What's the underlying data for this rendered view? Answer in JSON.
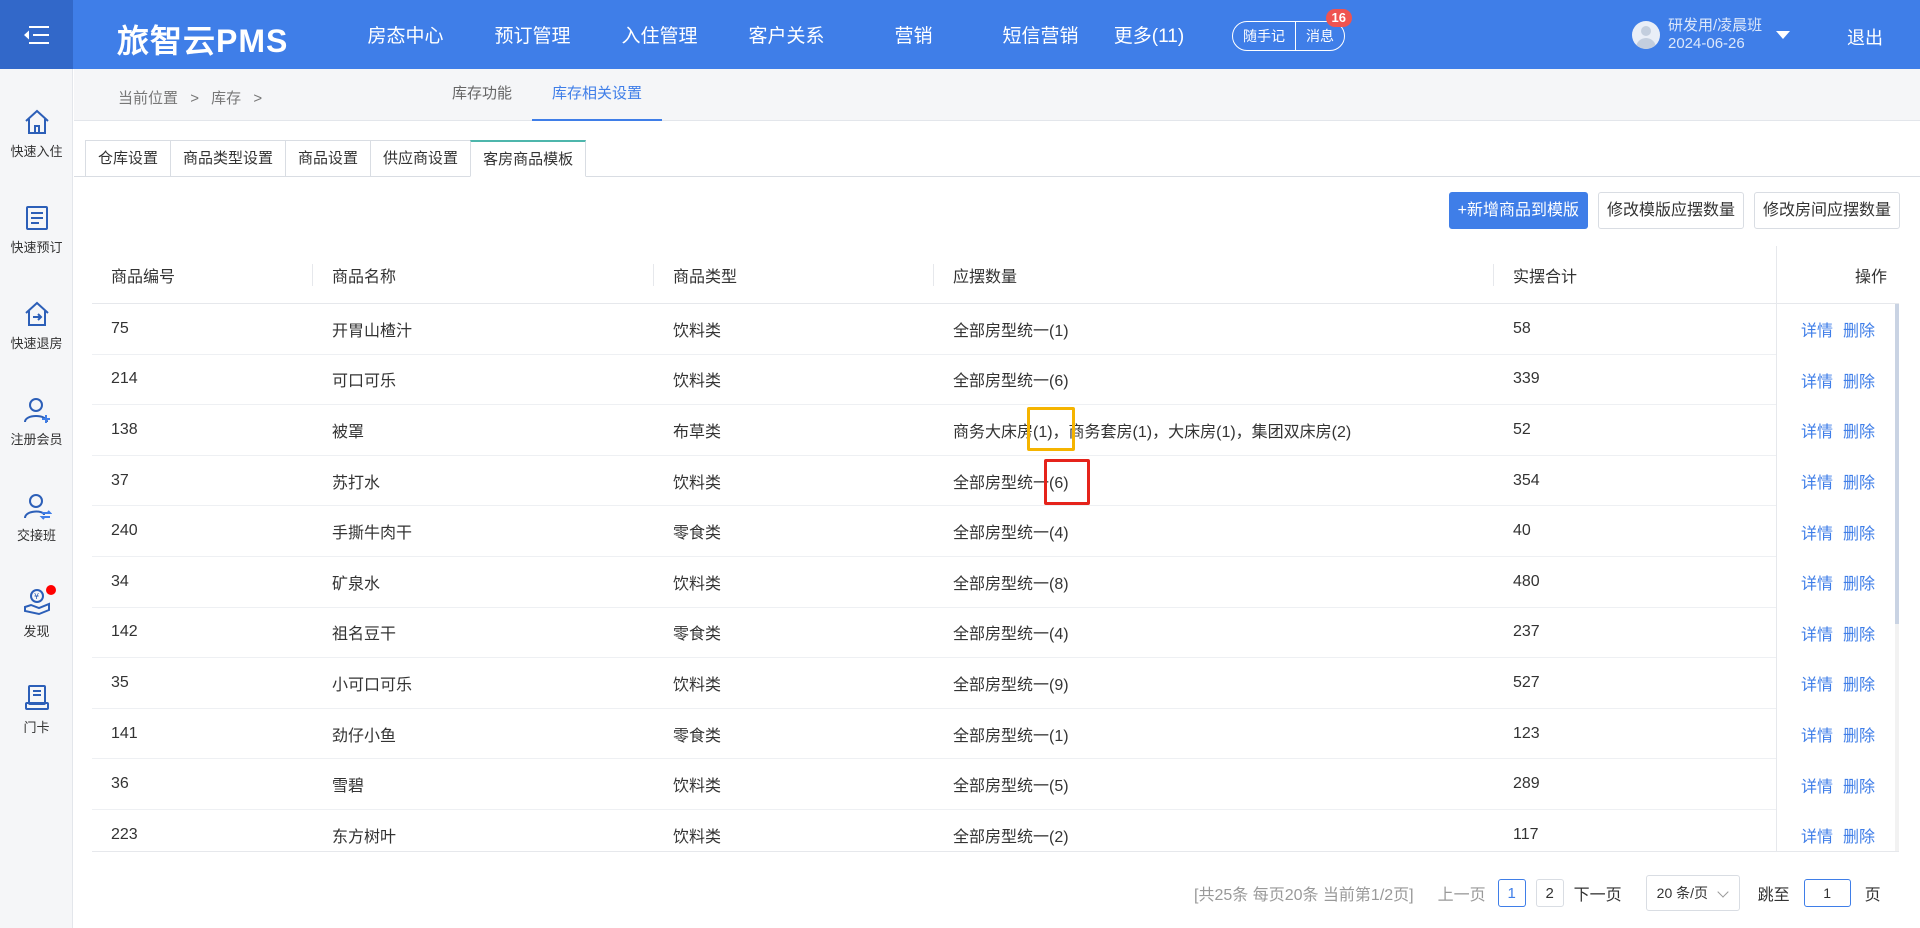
{
  "topbar": {
    "brand": "旅智云PMS",
    "nav": [
      "房态中心",
      "预订管理",
      "入住管理",
      "客户关系",
      "营销",
      "短信营销",
      "更多(11)"
    ],
    "notes_label": "随手记",
    "messages_label": "消息",
    "messages_badge": "16",
    "user_name": "研发用/凌晨班",
    "user_date": "2024-06-26",
    "logout_label": "退出"
  },
  "sidebar": {
    "items": [
      {
        "label": "快速入住",
        "icon": "home-icon"
      },
      {
        "label": "快速预订",
        "icon": "document-icon"
      },
      {
        "label": "快速退房",
        "icon": "checkout-icon"
      },
      {
        "label": "注册会员",
        "icon": "user-add-icon"
      },
      {
        "label": "交接班",
        "icon": "user-swap-icon"
      },
      {
        "label": "发现",
        "icon": "money-hand-icon"
      },
      {
        "label": "门卡",
        "icon": "card-icon"
      }
    ]
  },
  "breadcrumb": {
    "prefix": "当前位置",
    "sep": ">",
    "current": "库存",
    "sep2": ">"
  },
  "subnav": [
    "库存功能",
    "库存相关设置"
  ],
  "tabs": [
    "仓库设置",
    "商品类型设置",
    "商品设置",
    "供应商设置",
    "客房商品模板"
  ],
  "actions": {
    "add": "+新增商品到模版",
    "edit_template": "修改模版应摆数量",
    "edit_room": "修改房间应摆数量"
  },
  "table": {
    "headers": [
      "商品编号",
      "商品名称",
      "商品类型",
      "应摆数量",
      "实摆合计",
      "操作"
    ],
    "detail_label": "详情",
    "delete_label": "删除",
    "rows": [
      [
        "75",
        "开胃山楂汁",
        "饮料类",
        "全部房型统一(1)",
        "58"
      ],
      [
        "214",
        "可口可乐",
        "饮料类",
        "全部房型统一(6)",
        "339"
      ],
      [
        "138",
        "被罩",
        "布草类",
        "商务大床房(1)，商务套房(1)，大床房(1)，集团双床房(2)",
        "52"
      ],
      [
        "37",
        "苏打水",
        "饮料类",
        "全部房型统一(6)",
        "354"
      ],
      [
        "240",
        "手撕牛肉干",
        "零食类",
        "全部房型统一(4)",
        "40"
      ],
      [
        "34",
        "矿泉水",
        "饮料类",
        "全部房型统一(8)",
        "480"
      ],
      [
        "142",
        "祖名豆干",
        "零食类",
        "全部房型统一(4)",
        "237"
      ],
      [
        "35",
        "小可口可乐",
        "饮料类",
        "全部房型统一(9)",
        "527"
      ],
      [
        "141",
        "劲仔小鱼",
        "零食类",
        "全部房型统一(1)",
        "123"
      ],
      [
        "36",
        "雪碧",
        "饮料类",
        "全部房型统一(5)",
        "289"
      ],
      [
        "223",
        "东方树叶",
        "饮料类",
        "全部房型统一(2)",
        "117"
      ]
    ]
  },
  "pagination": {
    "summary": "[共25条 每页20条 当前第1/2页]",
    "prev": "上一页",
    "pages": [
      "1",
      "2"
    ],
    "next": "下一页",
    "page_size": "20 条/页",
    "jump_label": "跳至",
    "jump_value": "1",
    "page_suffix": "页"
  },
  "colors": {
    "brand": "#3f7ee8",
    "highlight_yellow": "#f5b400",
    "highlight_red": "#e5231b"
  }
}
